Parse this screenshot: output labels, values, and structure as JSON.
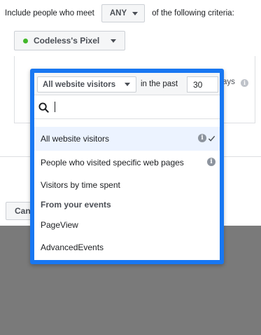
{
  "criteria": {
    "prefix": "Include people who meet",
    "match_value": "ANY",
    "suffix": "of the following criteria:"
  },
  "pixel": {
    "name": "Codeless's Pixel",
    "status_color": "#42b72a"
  },
  "retention": {
    "days_suffix": "ays",
    "info_icon": "info-icon"
  },
  "dropdown": {
    "selected_label": "All website visitors",
    "in_the_past_label": "in the past",
    "days_value": "30",
    "search": {
      "placeholder": "",
      "value": ""
    },
    "items": [
      {
        "label": "All website visitors",
        "selected": true,
        "info": true
      },
      {
        "label": "People who visited specific web pages",
        "selected": false,
        "info": true
      },
      {
        "label": "Visitors by time spent",
        "selected": false,
        "info": false
      },
      {
        "label": "From your events",
        "heading": true
      },
      {
        "label": "PageView",
        "selected": false,
        "info": false
      },
      {
        "label": "AdvancedEvents",
        "selected": false,
        "info": false
      }
    ],
    "accent_color": "#1877f2"
  },
  "footer": {
    "cancel_label": "Cancel"
  },
  "colors": {
    "overlay_gray": "#7a7a7a",
    "selected_row": "#ecf3ff"
  }
}
